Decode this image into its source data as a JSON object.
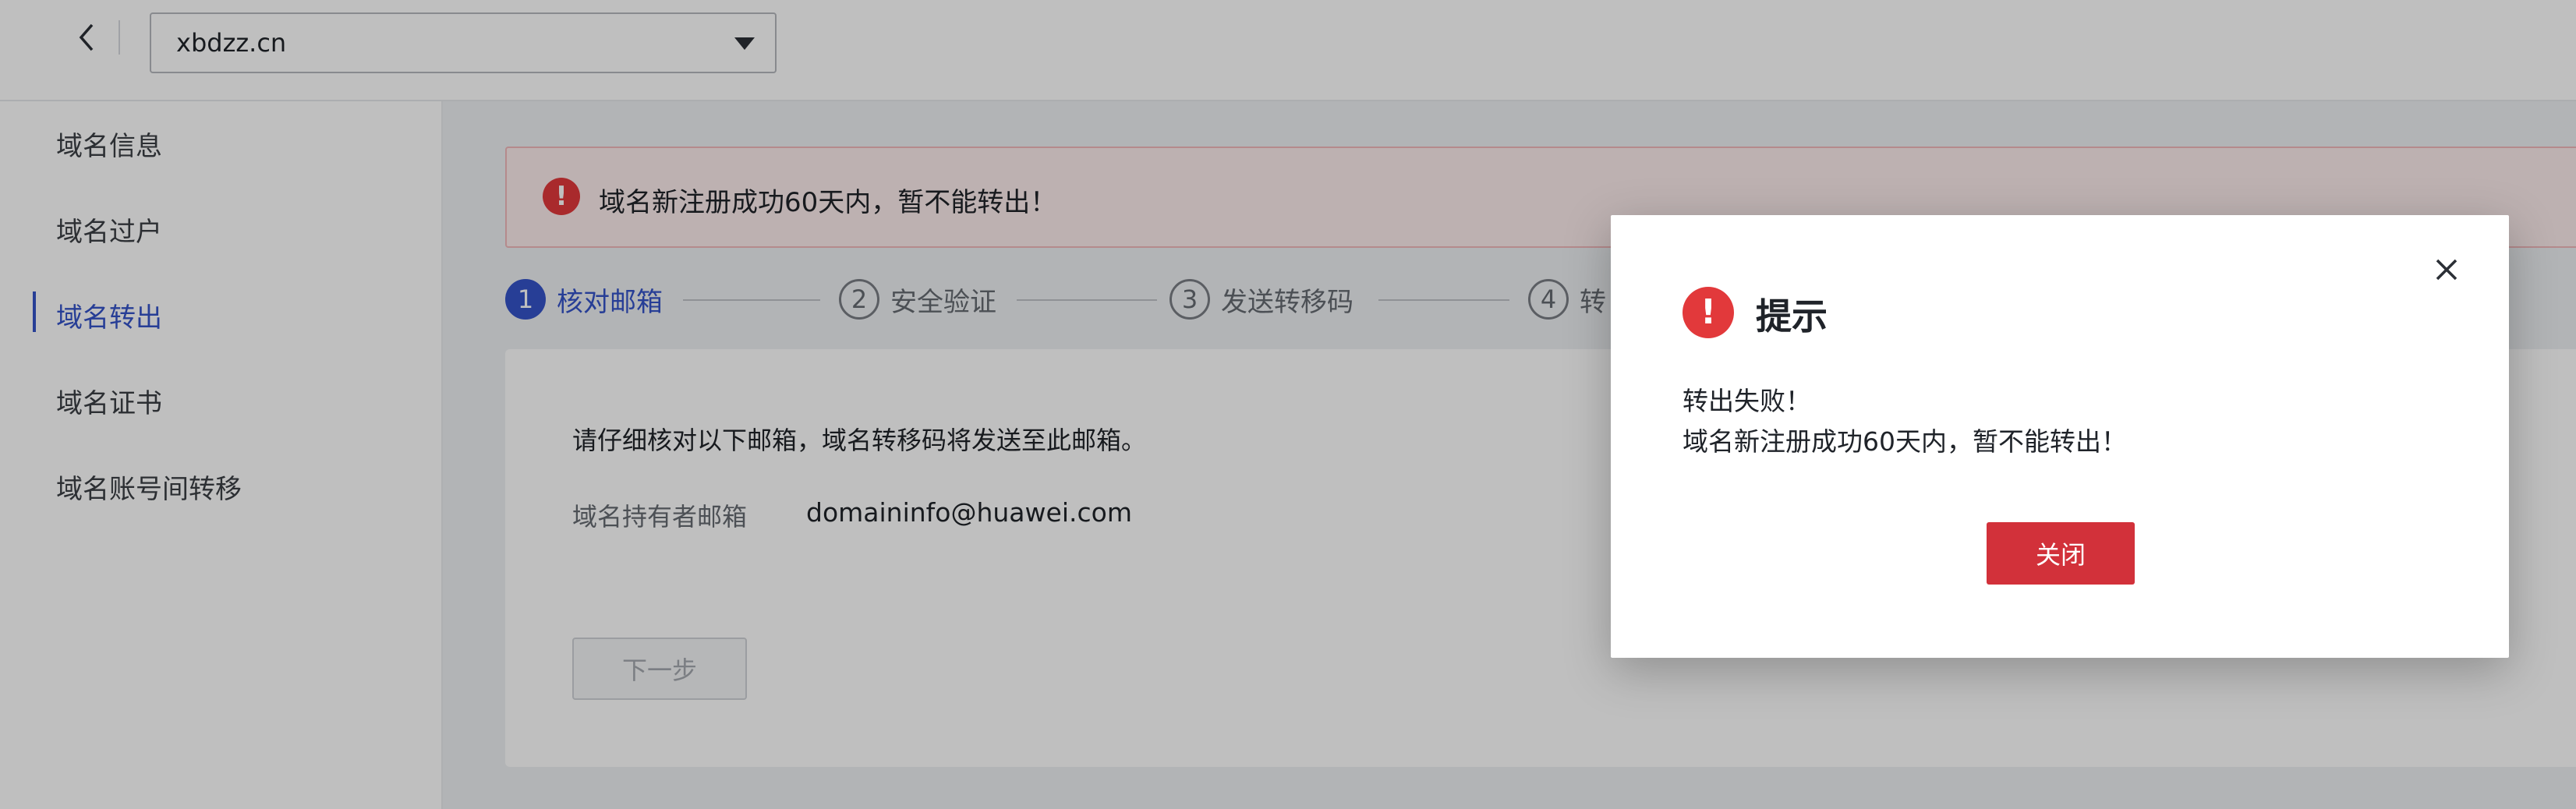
{
  "topbar": {
    "domain_select": {
      "value": "xbdzz.cn"
    },
    "back_icon": "chevron-left-icon"
  },
  "sidebar": {
    "items": [
      {
        "label": "域名信息",
        "active": false
      },
      {
        "label": "域名过户",
        "active": false
      },
      {
        "label": "域名转出",
        "active": true
      },
      {
        "label": "域名证书",
        "active": false
      },
      {
        "label": "域名账号间转移",
        "active": false
      }
    ]
  },
  "main": {
    "alert": {
      "text": "域名新注册成功60天内，暂不能转出！",
      "color": "#e2393b"
    },
    "steps": [
      {
        "num": "1",
        "label": "核对邮箱",
        "active": true
      },
      {
        "num": "2",
        "label": "安全验证",
        "active": false
      },
      {
        "num": "3",
        "label": "发送转移码",
        "active": false
      },
      {
        "num": "4",
        "label": "转",
        "active": false
      }
    ],
    "card": {
      "description": "请仔细核对以下邮箱，域名转移码将发送至此邮箱。",
      "email_label": "域名持有者邮箱",
      "email_value": "domaininfo@huawei.com",
      "next_button": "下一步"
    }
  },
  "dialog": {
    "title": "提示",
    "message_line1": "转出失败！",
    "message_line2": "域名新注册成功60天内，暂不能转出！",
    "close_button": "关闭",
    "accent_color": "#d2313a"
  }
}
